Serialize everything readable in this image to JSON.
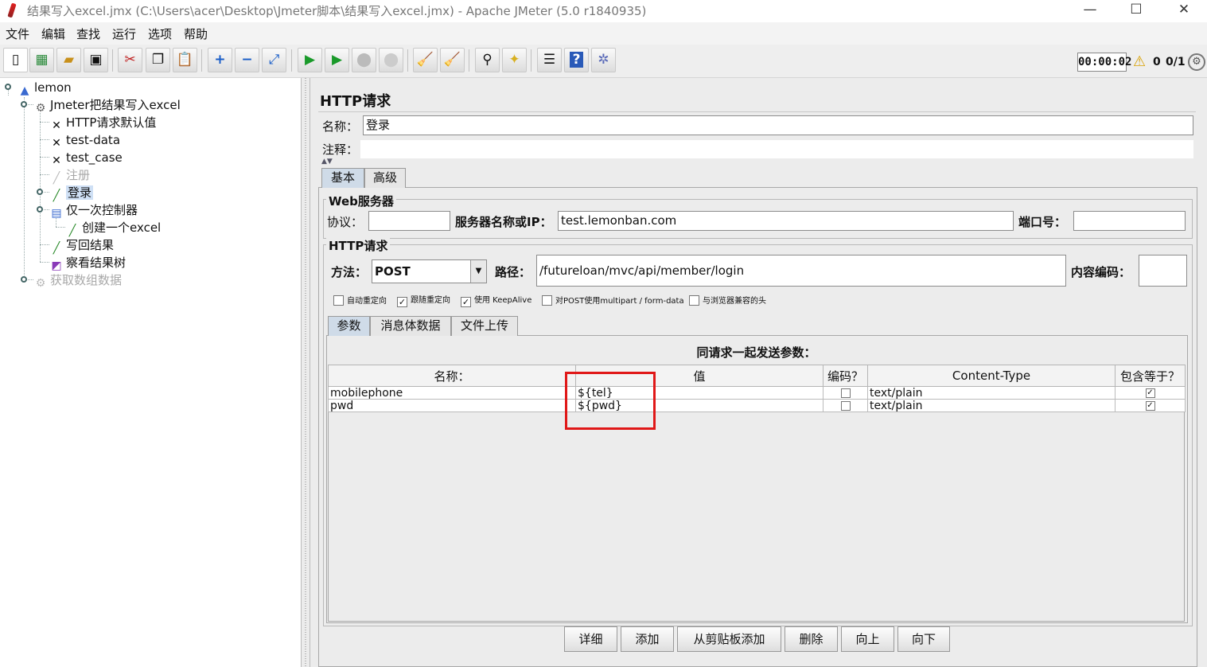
{
  "window": {
    "title": "结果写入excel.jmx (C:\\Users\\acer\\Desktop\\Jmeter脚本\\结果写入excel.jmx) - Apache JMeter (5.0 r1840935)",
    "minimize": "—",
    "maximize": "☐",
    "close": "✕"
  },
  "menu": [
    "文件",
    "编辑",
    "查找",
    "运行",
    "选项",
    "帮助"
  ],
  "toolbar": {
    "icons": [
      "new-icon",
      "templates-icon",
      "open-icon",
      "save-icon",
      "cut-icon",
      "copy-icon",
      "paste-icon",
      "expand-icon",
      "collapse-icon",
      "toggle-icon",
      "start-icon",
      "start-no-pause-icon",
      "stop-icon",
      "shutdown-icon",
      "clear-icon",
      "clear-all-icon",
      "search-icon",
      "reset-search-icon",
      "function-helper-icon",
      "help-icon",
      "remote-icon"
    ],
    "timer": "00:00:02",
    "warning_count": "0",
    "threads": "0/1"
  },
  "tree": {
    "nodes": [
      {
        "label": "lemon",
        "icon": "test-plan-icon"
      },
      {
        "label": "Jmeter把结果写入excel",
        "icon": "thread-group-icon"
      },
      {
        "label": "HTTP请求默认值",
        "icon": "config-element-icon"
      },
      {
        "label": "test-data",
        "icon": "config-element-icon"
      },
      {
        "label": "test_case",
        "icon": "config-element-icon"
      },
      {
        "label": "注册",
        "icon": "sampler-icon",
        "disabled": true
      },
      {
        "label": "登录",
        "icon": "sampler-icon",
        "selected": true
      },
      {
        "label": "仅一次控制器",
        "icon": "controller-icon"
      },
      {
        "label": "创建一个excel",
        "icon": "sampler-icon"
      },
      {
        "label": "写回结果",
        "icon": "sampler-icon"
      },
      {
        "label": "察看结果树",
        "icon": "listener-icon"
      },
      {
        "label": "获取数组数据",
        "icon": "thread-group-icon",
        "disabled": true
      }
    ]
  },
  "panel": {
    "title": "HTTP请求",
    "name_label": "名称：",
    "name_value": "登录",
    "comment_label": "注释：",
    "comment_value": "",
    "tabs": [
      "基本",
      "高级"
    ],
    "web_server": {
      "title": "Web服务器",
      "protocol_label": "协议：",
      "protocol_value": "",
      "server_label": "服务器名称或IP：",
      "server_value": "test.lemonban.com",
      "port_label": "端口号：",
      "port_value": ""
    },
    "http_request": {
      "title": "HTTP请求",
      "method_label": "方法：",
      "method_value": "POST",
      "path_label": "路径：",
      "path_value": "/futureloan/mvc/api/member/login",
      "encoding_label": "内容编码：",
      "encoding_value": ""
    },
    "options": [
      {
        "label": "自动重定向",
        "checked": false
      },
      {
        "label": "跟随重定向",
        "checked": true
      },
      {
        "label": "使用 KeepAlive",
        "checked": true
      },
      {
        "label": "对POST使用multipart / form-data",
        "checked": false
      },
      {
        "label": "与浏览器兼容的头",
        "checked": false
      }
    ],
    "subtabs": [
      "参数",
      "消息体数据",
      "文件上传"
    ],
    "params_title": "同请求一起发送参数：",
    "columns": [
      "名称：",
      "值",
      "编码？",
      "Content-Type",
      "包含等于？"
    ],
    "rows": [
      {
        "name": "mobilephone",
        "value": "${tel}",
        "encode": false,
        "content_type": "text/plain",
        "include_equals": true
      },
      {
        "name": "pwd",
        "value": "${pwd}",
        "encode": false,
        "content_type": "text/plain",
        "include_equals": true
      }
    ],
    "buttons": [
      "详细",
      "添加",
      "从剪贴板添加",
      "删除",
      "向上",
      "向下"
    ]
  },
  "accent_colors": {
    "selection": "#cfe0f5",
    "highlight_box": "#e01818"
  }
}
